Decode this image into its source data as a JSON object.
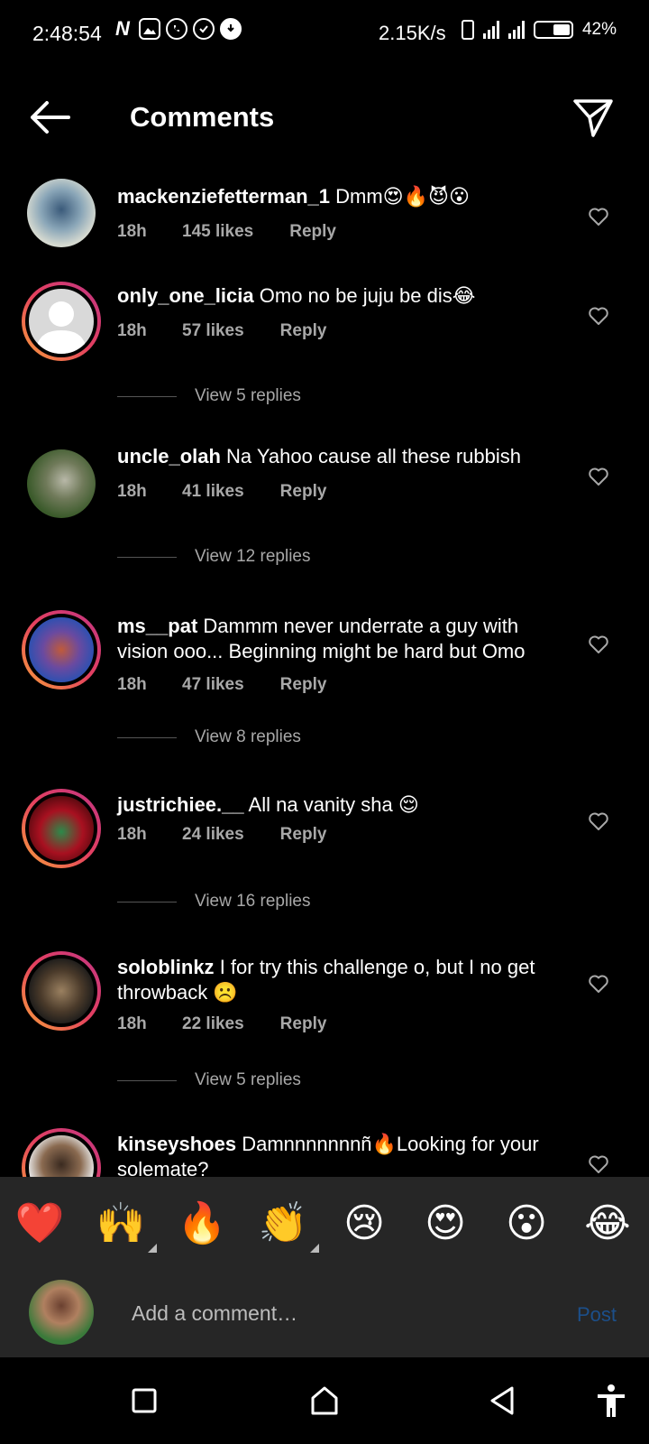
{
  "status_bar": {
    "time": "2:48:54",
    "speed": "2.15K/s",
    "battery": "42%",
    "icons": [
      "netflix-n-icon",
      "gallery-icon",
      "whatsapp-icon",
      "check-circle-icon",
      "download-icon"
    ]
  },
  "header": {
    "title": "Comments"
  },
  "comments": [
    {
      "user": "mackenziefetterman_1",
      "text": "Dmm😍🔥😈😮",
      "time": "18h",
      "likes": "145 likes",
      "reply": "Reply"
    },
    {
      "user": "only_one_licia",
      "text": "Omo no be juju be dis😂",
      "time": "18h",
      "likes": "57 likes",
      "reply": "Reply",
      "view_replies": "View 5 replies"
    },
    {
      "user": "uncle_olah",
      "text": "Na Yahoo cause all these rubbish",
      "time": "18h",
      "likes": "41 likes",
      "reply": "Reply",
      "view_replies": "View 12 replies"
    },
    {
      "user": "ms__pat",
      "text": "Dammm never underrate a guy with vision ooo... Beginning might be hard but Omo",
      "time": "18h",
      "likes": "47 likes",
      "reply": "Reply",
      "view_replies": "View 8 replies"
    },
    {
      "user": "justrichiee.__",
      "text": "All na vanity sha 😌",
      "time": "18h",
      "likes": "24 likes",
      "reply": "Reply",
      "view_replies": "View 16 replies"
    },
    {
      "user": "soloblinkz",
      "text": "I for try this challenge o, but I no get throwback ☹️",
      "time": "18h",
      "likes": "22 likes",
      "reply": "Reply",
      "view_replies": "View 5 replies"
    },
    {
      "user": "kinseyshoes",
      "text": "Damnnnnnnnñ🔥Looking for your solemate?"
    }
  ],
  "emoji_bar": [
    "❤️",
    "🙌",
    "🔥",
    "👏",
    "😢",
    "😍",
    "😮",
    "😂"
  ],
  "input": {
    "placeholder": "Add a comment…",
    "post": "Post"
  },
  "colors": {
    "background": "#000000",
    "bar": "#262626",
    "meta_text": "#a8a8a8",
    "post_disabled": "#1c4f8a",
    "story_ring": "#e4405f"
  }
}
